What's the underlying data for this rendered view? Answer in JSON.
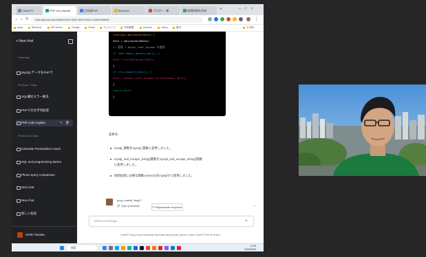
{
  "browser": {
    "tabs": [
      {
        "label": "ChatGPT"
      },
      {
        "label": "PHP mb_expand"
      },
      {
        "label": "日本語PHP"
      },
      {
        "label": "Bluehost"
      },
      {
        "label": "ブロガー - 新"
      },
      {
        "label": "新規投稿を作成"
      }
    ],
    "url": "chat.openai.com/c/8a1b3e1d-0d2e-4a7b-9f2e-1a2b3c4d5e6f",
    "bookmarks": [
      "Apps",
      "Bluehost",
      "WP Admin",
      "Google",
      "Gmail",
      "マイページ",
      "予約管理",
      "Amazon",
      "Yahoo",
      "楽天",
      "その他"
    ]
  },
  "sidebar": {
    "new_chat_label": "+ New chat",
    "sections": {
      "today": "Yesterday",
      "prev": "Previous 7 Days",
      "prev30": "Previous 30 Days"
    },
    "items": [
      {
        "label": "MySQLデータをPHPで"
      },
      {
        "label": "SQL構文エラー解決"
      },
      {
        "label": "PHPでの文字列処理"
      },
      {
        "label": "PHP code explain"
      },
      {
        "label": "Calculate Presentation Hours"
      },
      {
        "label": "SQL and programming basics"
      },
      {
        "label": "Phone query comparison"
      },
      {
        "label": "New chat"
      },
      {
        "label": "New chat"
      },
      {
        "label": "新しい会話"
      }
    ],
    "user_name": "Hiroki Tanaka"
  },
  "code": {
    "lines": [
      "  function mb(convertData) {",
      "    $txt = mb(convertData);",
      "    // 変換 = mysql_real_escape  を使用",
      "    if (get_magic_quotes_gpc()) {",
      "      $txt = stripslashes($txt);",
      "    }",
      "    if (!is_numeric($txt)) {",
      "      $txt = mysqli_real_escape_string($conn, $txt);",
      "    }",
      "    return $txt;",
      "  }"
    ]
  },
  "reply": {
    "intro": "変更点：",
    "bullets": [
      "mysql_関数をmysqli_関数に変更しました。",
      "mysql_real_escape_string()関数をmysqli_real_escape_string()関数",
      "に変更しました。",
      "接続処理に必要な関数connect()をmysqliから使用しました。"
    ]
  },
  "answer": {
    "line1": "preg_match(\"/img(?:\"",
    "line2": "が \"/(\\s)+(Canvas)\""
  },
  "regen_label": "↻ Regenerate response",
  "input_placeholder": "Send a message...",
  "footer_note": "ChatGPT may produce inaccurate information about people, places, or facts. ChatGPT Mar 23 Version",
  "taskbar": {
    "search_label": "検索",
    "time": "11:05",
    "date": "2023/04/06"
  },
  "colors": {
    "sidebar_bg": "#202123",
    "code_bg": "#000000",
    "accent_chatgpt": "#10a37f"
  }
}
